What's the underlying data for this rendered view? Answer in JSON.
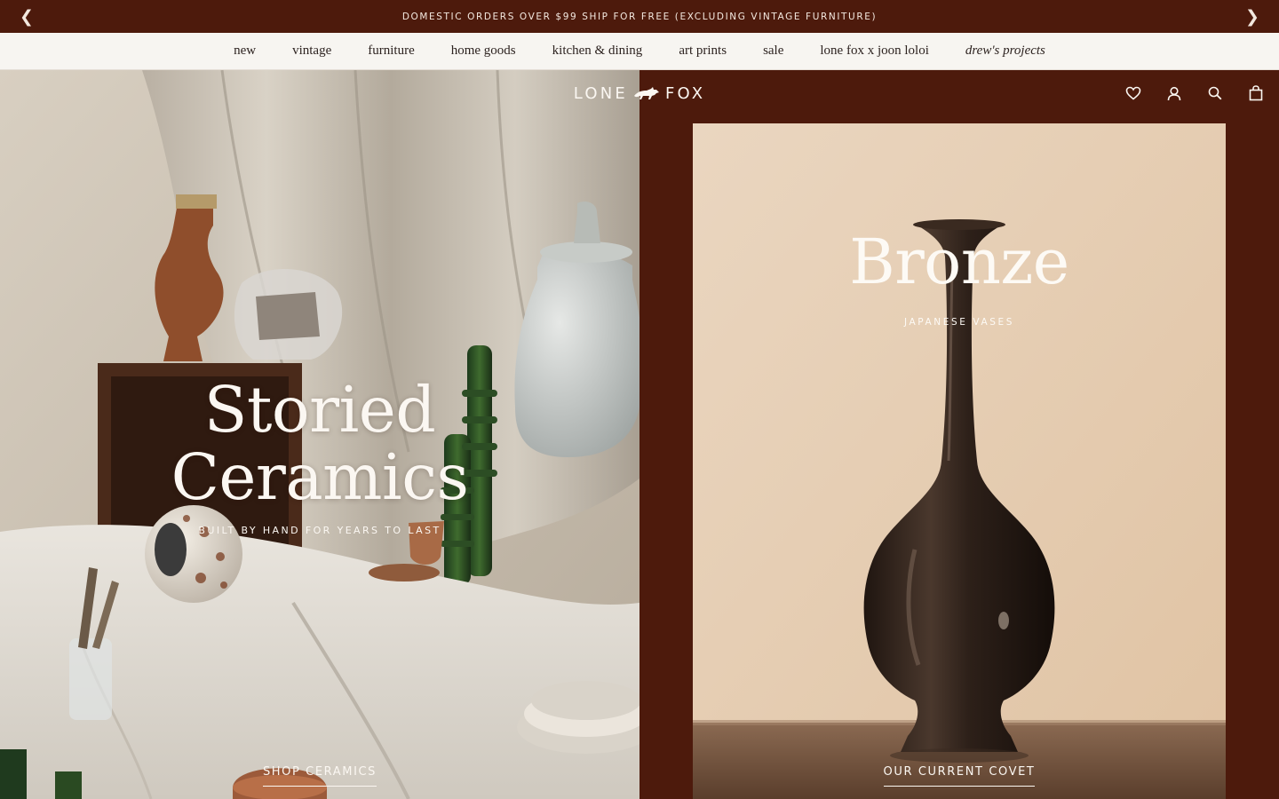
{
  "announcement": {
    "text": "DOMESTIC ORDERS OVER $99 SHIP FOR FREE (EXCLUDING VINTAGE FURNITURE)",
    "prev_icon": "❮",
    "next_icon": "❯"
  },
  "nav": {
    "items": [
      {
        "label": "new"
      },
      {
        "label": "vintage"
      },
      {
        "label": "furniture"
      },
      {
        "label": "home goods"
      },
      {
        "label": "kitchen & dining"
      },
      {
        "label": "art prints"
      },
      {
        "label": "sale"
      },
      {
        "label": "lone fox x joon loloi"
      },
      {
        "label": "drew's projects"
      }
    ]
  },
  "header": {
    "logo_left": "LONE",
    "logo_right": "FOX",
    "icons": [
      "heart-icon",
      "account-icon",
      "search-icon",
      "bag-icon"
    ]
  },
  "left_panel": {
    "title_line1": "Storied",
    "title_line2": "Ceramics",
    "subtitle": "BUILT BY HAND FOR YEARS TO LAST",
    "cta": "SHOP CERAMICS"
  },
  "right_panel": {
    "title": "Bronze",
    "subtitle": "JAPANESE VASES",
    "cta": "OUR CURRENT COVET"
  },
  "colors": {
    "brand_brown": "#4d1a0c",
    "nav_bg": "#f7f5f1",
    "cream_text": "#fbf7f2"
  }
}
